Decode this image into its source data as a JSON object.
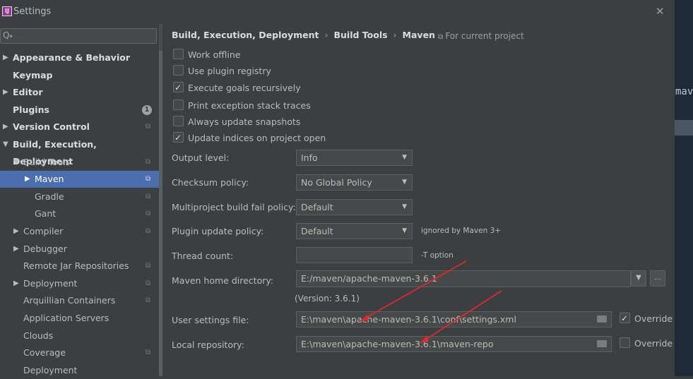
{
  "window": {
    "title": "Settings",
    "close_glyph": "✕",
    "app_icon_text": "IJ"
  },
  "background_text": "mav",
  "search": {
    "placeholder": "",
    "icon": "search-icon"
  },
  "tree": [
    {
      "label": "Appearance & Behavior",
      "bold": true,
      "arrow": "▶"
    },
    {
      "label": "Keymap",
      "bold": true
    },
    {
      "label": "Editor",
      "bold": true,
      "arrow": "▶"
    },
    {
      "label": "Plugins",
      "bold": true,
      "badge": "1"
    },
    {
      "label": "Version Control",
      "bold": true,
      "arrow": "▶",
      "project": true
    },
    {
      "label": "Build, Execution, Deployment",
      "bold": true,
      "arrow": "▼"
    },
    {
      "label": "Build Tools",
      "arrow": "▼",
      "project": true
    },
    {
      "label": "Maven",
      "arrow": "▶",
      "project": true,
      "selected": true
    },
    {
      "label": "Gradle",
      "project": true
    },
    {
      "label": "Gant",
      "project": true
    },
    {
      "label": "Compiler",
      "arrow": "▶",
      "project": true
    },
    {
      "label": "Debugger",
      "arrow": "▶"
    },
    {
      "label": "Remote Jar Repositories",
      "project": true
    },
    {
      "label": "Deployment",
      "arrow": "▶",
      "project": true
    },
    {
      "label": "Arquillian Containers",
      "project": true
    },
    {
      "label": "Application Servers"
    },
    {
      "label": "Clouds"
    },
    {
      "label": "Coverage",
      "project": true
    },
    {
      "label": "Deployment"
    }
  ],
  "breadcrumb": {
    "items": [
      "Build, Execution, Deployment",
      "Build Tools",
      "Maven"
    ],
    "separator": "›"
  },
  "for_current_project": "For current project",
  "checkboxes": [
    {
      "label": "Work offline",
      "checked": false
    },
    {
      "label": "Use plugin registry",
      "checked": false
    },
    {
      "label": "Execute goals recursively",
      "checked": true
    },
    {
      "label": "Print exception stack traces",
      "checked": false
    },
    {
      "label": "Always update snapshots",
      "checked": false
    },
    {
      "label": "Update indices on project open",
      "checked": true
    }
  ],
  "output_level": {
    "label": "Output level:",
    "value": "Info"
  },
  "checksum_policy": {
    "label": "Checksum policy:",
    "value": "No Global Policy"
  },
  "multiproject_policy": {
    "label": "Multiproject build fail policy:",
    "value": "Default"
  },
  "plugin_update_policy": {
    "label": "Plugin update policy:",
    "value": "Default",
    "note": "ignored by Maven 3+"
  },
  "thread_count": {
    "label": "Thread count:",
    "value": "",
    "note": "-T option"
  },
  "maven_home": {
    "label": "Maven home directory:",
    "value": "E:/maven/apache-maven-3.6.1",
    "version": "(Version: 3.6.1)",
    "browse": "..."
  },
  "user_settings": {
    "label": "User settings file:",
    "value": "E:\\maven\\apache-maven-3.6.1\\conf\\settings.xml",
    "override_label": "Override",
    "override_checked": true
  },
  "local_repository": {
    "label": "Local repository:",
    "value": "E:\\maven\\apache-maven-3.6.1\\maven-repo",
    "override_label": "Override",
    "override_checked": false
  },
  "colors": {
    "background": "#3c3f41",
    "selection": "#4b6eaf",
    "annotation_arrow": "#e02828"
  }
}
